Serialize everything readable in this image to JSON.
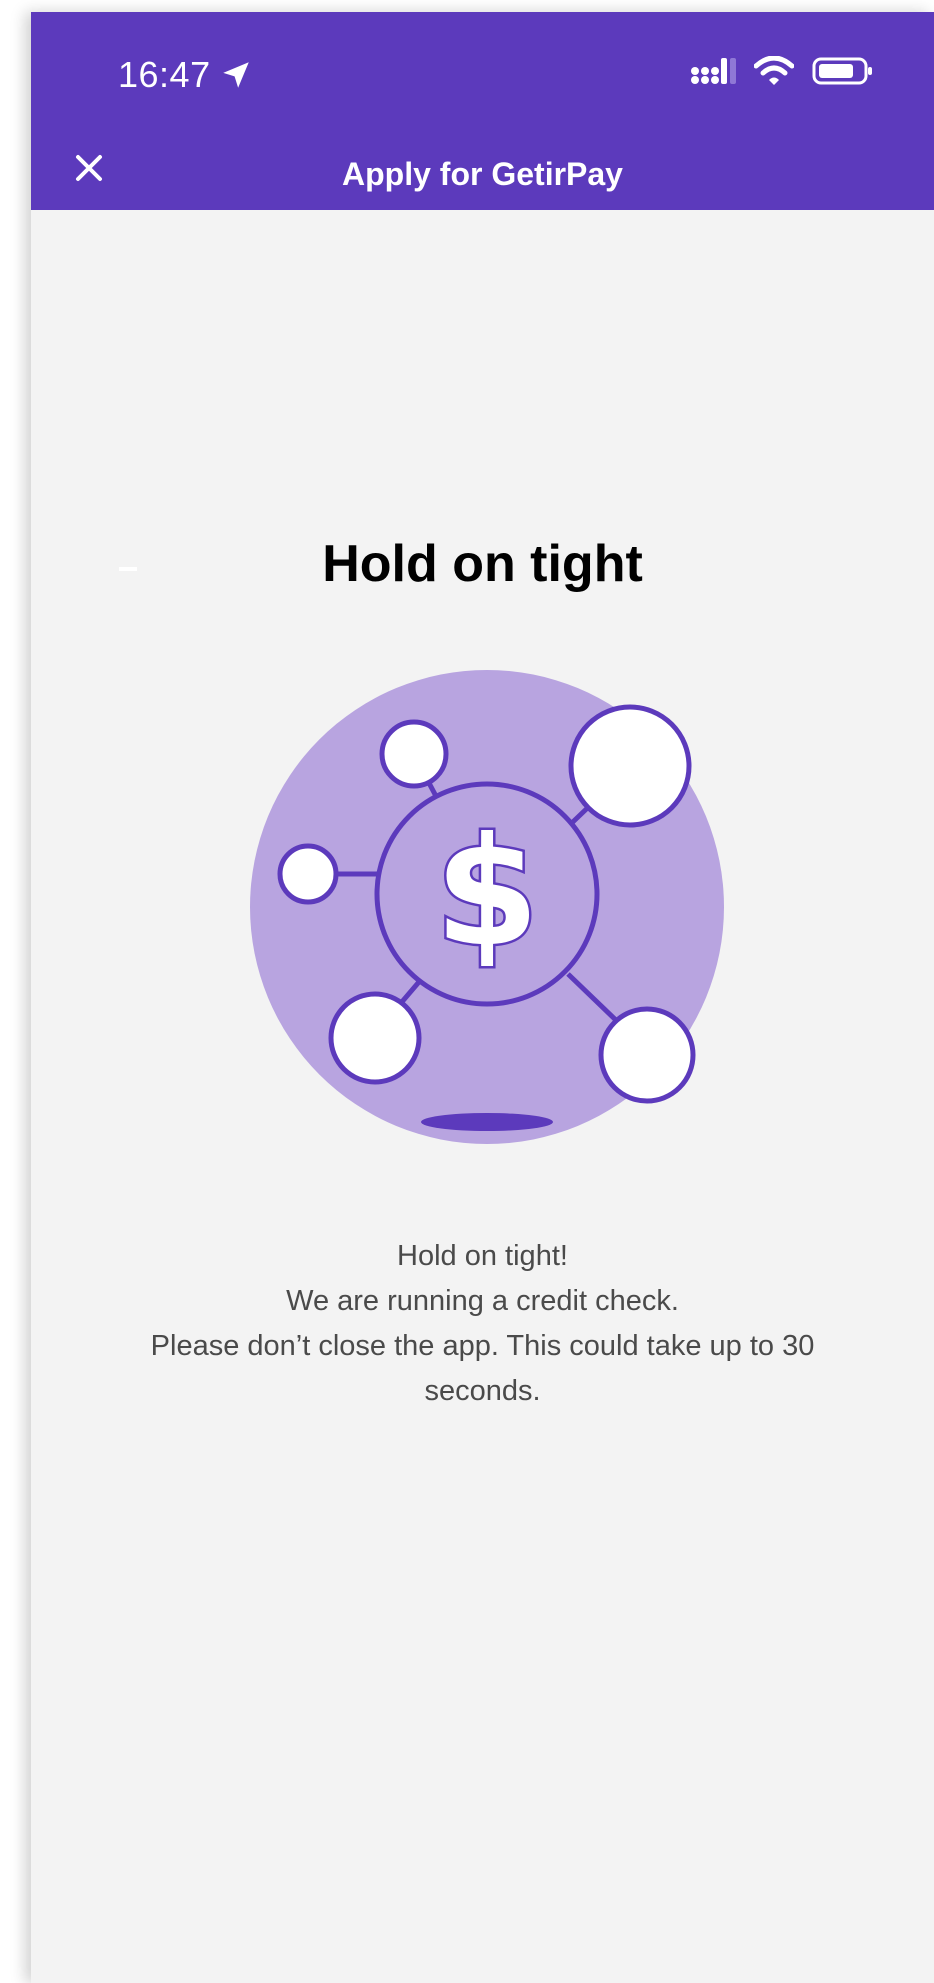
{
  "status_bar": {
    "time": "16:47"
  },
  "header": {
    "title": "Apply for GetirPay"
  },
  "content": {
    "heading": "Hold on tight",
    "message_lines": [
      "Hold on tight!",
      "We are running a credit check.",
      "Please don’t close the app. This could take up to 30",
      "seconds."
    ]
  },
  "colors": {
    "brand_purple": "#5c3abc",
    "illustration_fill": "#b8a4e0",
    "background": "#f3f3f3"
  },
  "icons": {
    "close": "close-icon",
    "location": "location-arrow-icon",
    "signal": "signal-icon",
    "wifi": "wifi-icon",
    "battery": "battery-icon",
    "dollar": "dollar-network-icon"
  }
}
